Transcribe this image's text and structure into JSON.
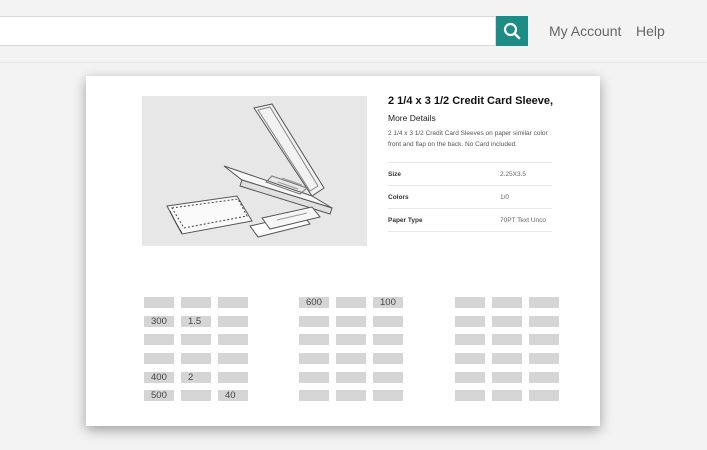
{
  "header": {
    "search_placeholder": "",
    "account_label": "My Account",
    "help_label": "Help"
  },
  "colors": {
    "accent": "#1e8c86",
    "cell": "#d5d5d5"
  },
  "icons": {
    "search": "search-icon"
  },
  "product": {
    "title": "2 1/4 x 3 1/2 Credit Card Sleeve,",
    "more_details": "More Details",
    "description": "2 1/4 x 3 1/2 Credit Card Sleeves on paper similar color front and flap on the back. No Card included.",
    "image_alt": "laptop-and-credit-card-sleeve-sketch",
    "specs": [
      {
        "label": "Size",
        "value": "2.25X3.5"
      },
      {
        "label": "Colors",
        "value": "1/0"
      },
      {
        "label": "Paper Type",
        "value": "70PT Text Unco"
      }
    ]
  },
  "price_grid": {
    "groups": [
      {
        "rows": [
          [
            "",
            "",
            ""
          ],
          [
            "300",
            "1.5",
            ""
          ],
          [
            "",
            "",
            ""
          ],
          [
            "",
            "",
            ""
          ],
          [
            "400",
            "2",
            ""
          ],
          [
            "500",
            "",
            "40"
          ]
        ]
      },
      {
        "rows": [
          [
            "600",
            "",
            "100"
          ],
          [
            "",
            "",
            ""
          ],
          [
            "",
            "",
            ""
          ],
          [
            "",
            "",
            ""
          ],
          [
            "",
            "",
            ""
          ],
          [
            "",
            "",
            ""
          ]
        ]
      },
      {
        "rows": [
          [
            "",
            "",
            ""
          ],
          [
            "",
            "",
            ""
          ],
          [
            "",
            "",
            ""
          ],
          [
            "",
            "",
            ""
          ],
          [
            "",
            "",
            ""
          ],
          [
            "",
            "",
            ""
          ]
        ]
      }
    ]
  }
}
